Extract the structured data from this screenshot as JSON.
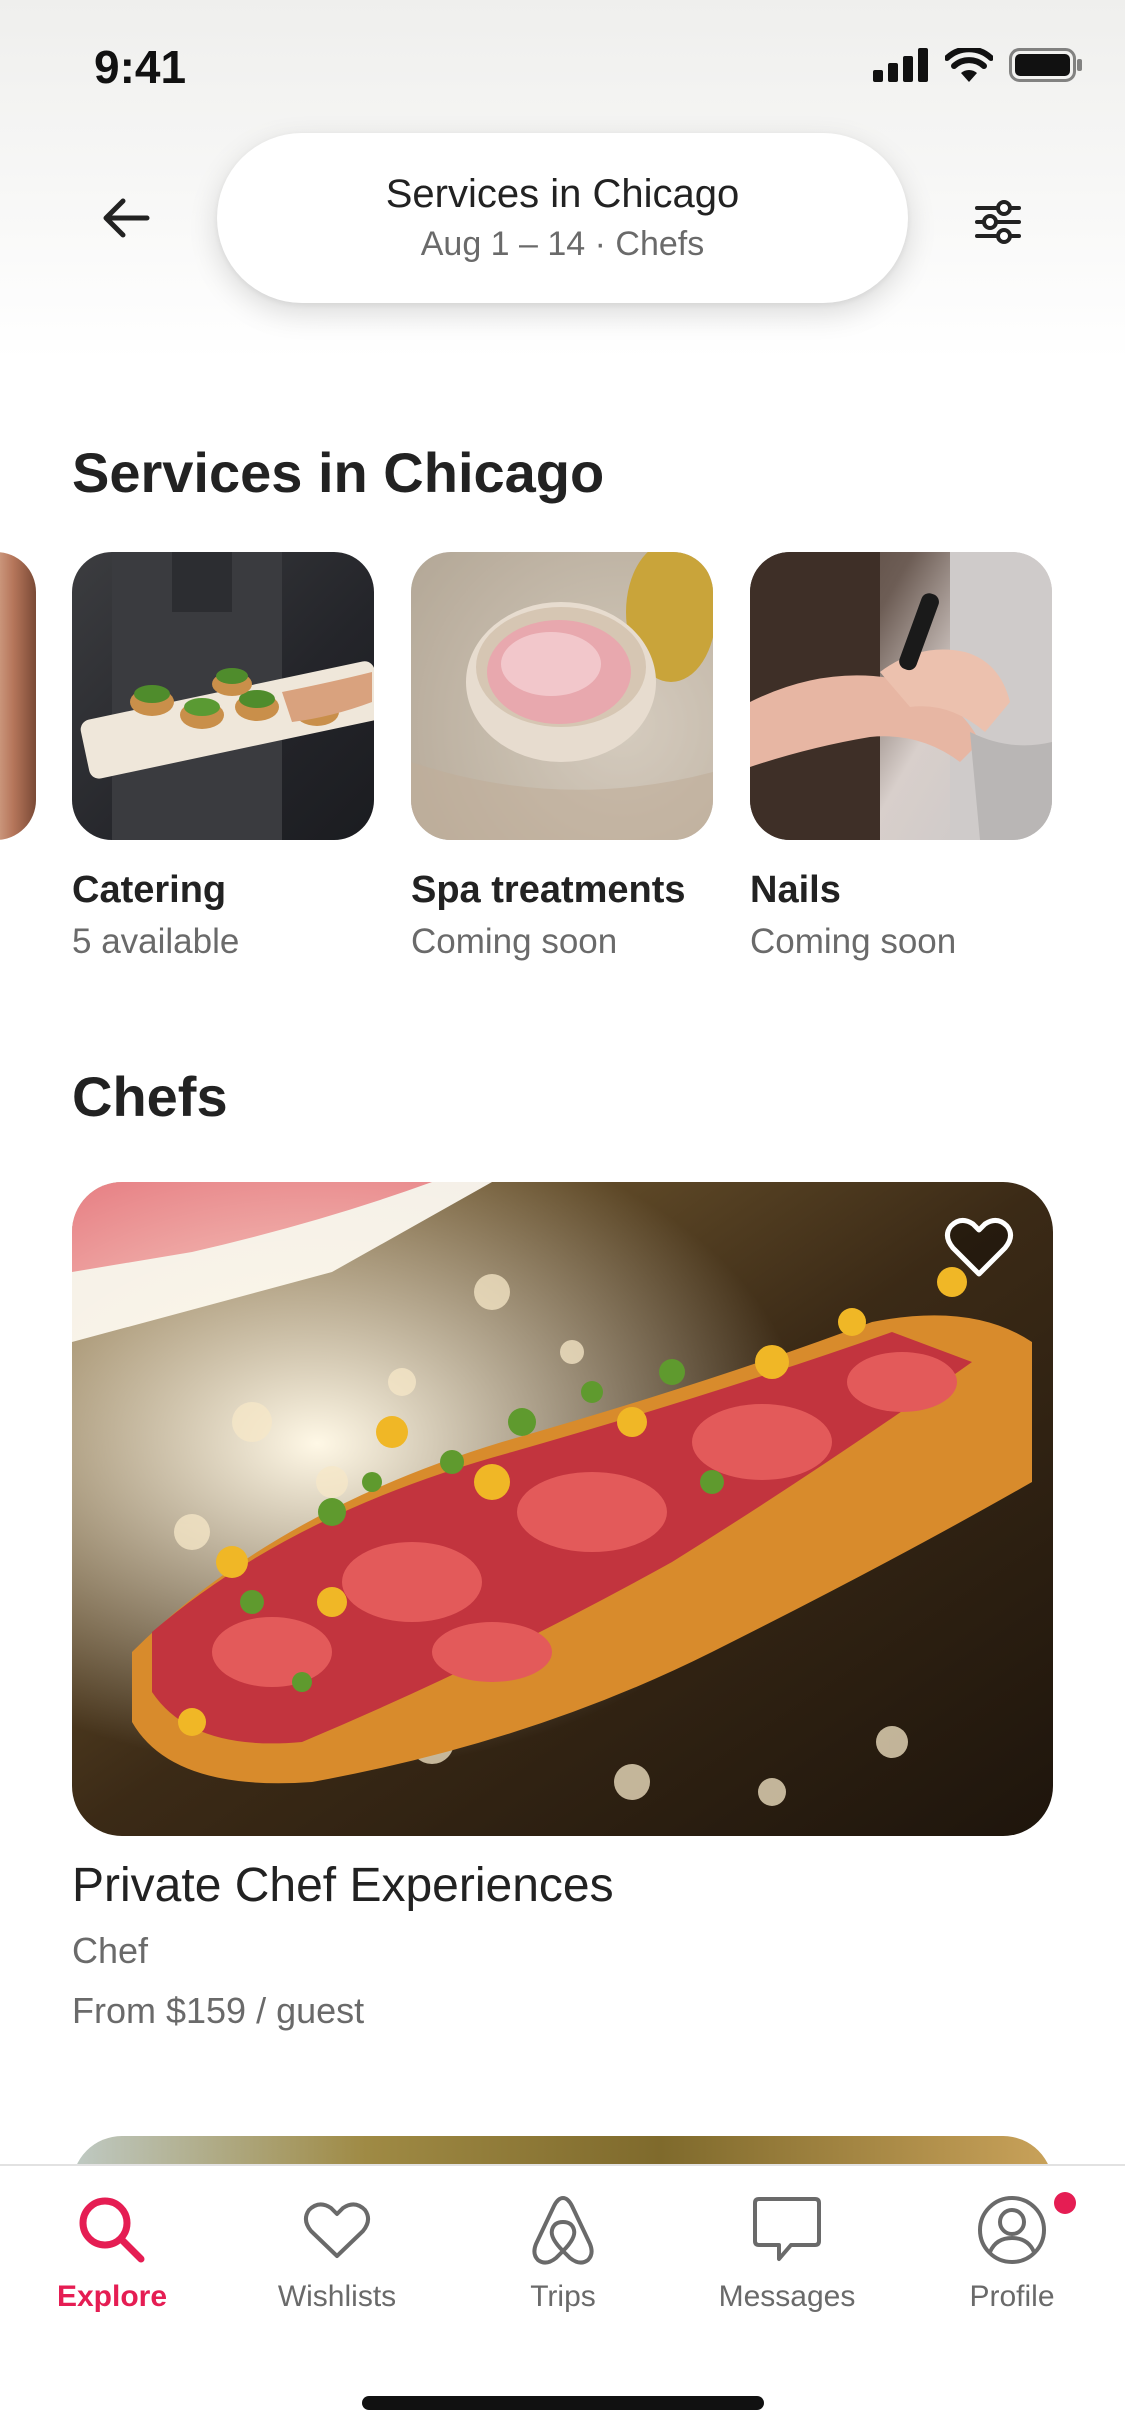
{
  "status_bar": {
    "time": "9:41"
  },
  "header": {
    "title": "Services in Chicago",
    "subtitle": "Aug 1 – 14 · Chefs"
  },
  "services": {
    "title": "Services in Chicago",
    "items": [
      {
        "label": "Catering",
        "status": "5 available"
      },
      {
        "label": "Spa treatments",
        "status": "Coming soon"
      },
      {
        "label": "Nails",
        "status": "Coming soon"
      }
    ]
  },
  "chefs": {
    "title": "Chefs",
    "listing": {
      "title": "Private Chef Experiences",
      "type": "Chef",
      "price": "From $159 / guest"
    }
  },
  "tabbar": {
    "tabs": [
      {
        "label": "Explore",
        "icon": "search-icon",
        "active": true
      },
      {
        "label": "Wishlists",
        "icon": "heart-icon"
      },
      {
        "label": "Trips",
        "icon": "airbnb-logo-icon"
      },
      {
        "label": "Messages",
        "icon": "message-icon"
      },
      {
        "label": "Profile",
        "icon": "profile-icon",
        "badge": true
      }
    ]
  },
  "colors": {
    "accent": "#e51d53",
    "text": "#222222",
    "muted": "#6a6a6a"
  }
}
